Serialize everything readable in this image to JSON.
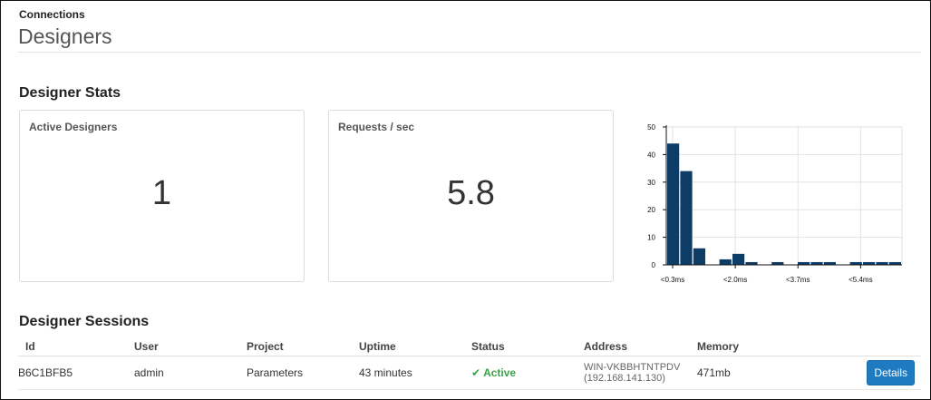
{
  "breadcrumb": "Connections",
  "page_title": "Designers",
  "stats": {
    "title": "Designer Stats",
    "cards": [
      {
        "label": "Active Designers",
        "value": "1"
      },
      {
        "label": "Requests / sec",
        "value": "5.8"
      }
    ]
  },
  "chart_data": {
    "type": "bar",
    "y_ticks": [
      "50",
      "40",
      "30",
      "20",
      "10",
      "0"
    ],
    "ylim": [
      0,
      50
    ],
    "x_tick_labels": [
      "<0.3ms",
      "<2.0ms",
      "<3.7ms",
      "<5.4ms"
    ],
    "values": [
      44,
      34,
      6,
      0,
      2,
      4,
      1,
      0,
      1,
      0,
      1,
      1,
      1,
      0,
      1,
      1,
      1,
      1
    ],
    "bar_color": "#0d3d66",
    "grid": true
  },
  "sessions": {
    "title": "Designer Sessions",
    "columns": [
      "Id",
      "User",
      "Project",
      "Uptime",
      "Status",
      "Address",
      "Memory"
    ],
    "rows": [
      {
        "id": "B6C1BFB5",
        "user": "admin",
        "project": "Parameters",
        "uptime": "43 minutes",
        "status": "Active",
        "address_host": "WIN-VKBBHTNTPDV",
        "address_ip": "(192.168.141.130)",
        "memory": "471mb",
        "action": "Details"
      }
    ]
  },
  "colors": {
    "accent": "#1f7bc1",
    "status_active": "#3ca24a"
  }
}
